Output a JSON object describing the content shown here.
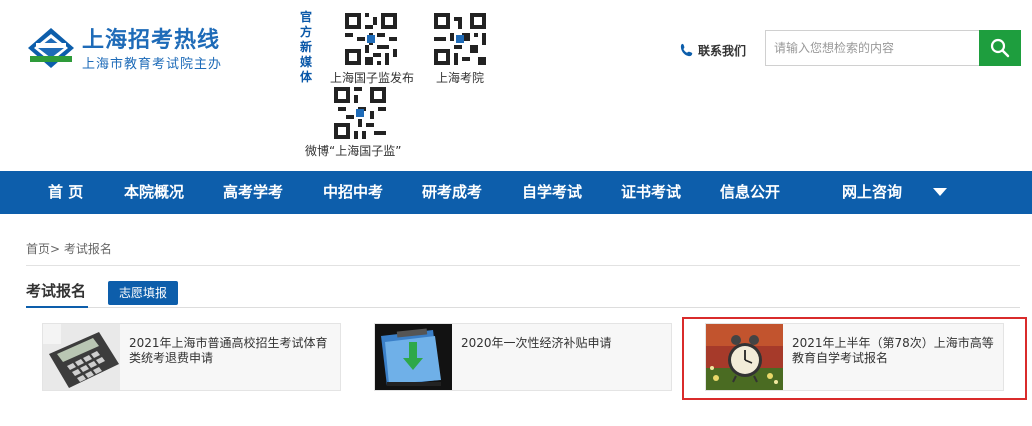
{
  "header": {
    "site_title": "上海招考热线",
    "site_subtitle": "上海市教育考试院主办",
    "media_label": "官方新媒体",
    "qr_codes": [
      {
        "caption": "上海国子监发布"
      },
      {
        "caption": "上海考院"
      },
      {
        "caption": "微博“上海国子监”"
      }
    ],
    "contact_label": "联系我们",
    "search_placeholder": "请输入您想检索的内容"
  },
  "nav": {
    "items": [
      "首 页",
      "本院概况",
      "高考学考",
      "中招中考",
      "研考成考",
      "自学考试",
      "证书考试",
      "信息公开",
      "网上咨询"
    ]
  },
  "breadcrumb": {
    "home": "首页",
    "separator": ">",
    "current": "考试报名"
  },
  "tabs": {
    "active": "考试报名",
    "other": "志愿填报"
  },
  "cards": [
    {
      "title": "2021年上海市普通高校招生考试体育类统考退费申请",
      "thumb": "calculator"
    },
    {
      "title": "2020年一次性经济补贴申请",
      "thumb": "download-folder"
    },
    {
      "title": "2021年上半年（第78次）上海市高等教育自学考试报名",
      "thumb": "alarm-clock"
    }
  ],
  "colors": {
    "brand_blue": "#0d5eab",
    "search_green": "#1e9e3e",
    "highlight_red": "#d92b2b"
  }
}
